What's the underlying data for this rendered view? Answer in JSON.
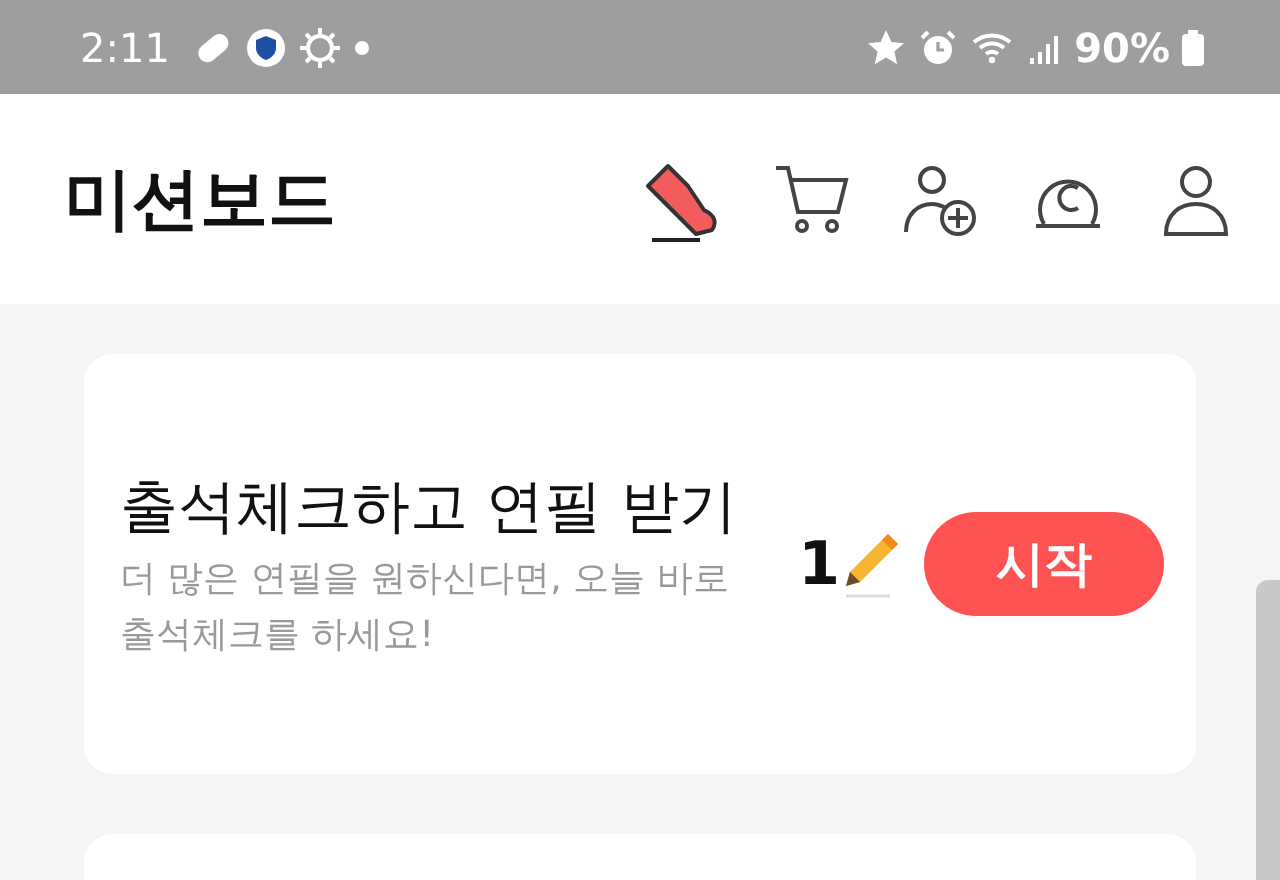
{
  "status_bar": {
    "time": "2:11",
    "battery": "90%"
  },
  "header": {
    "title": "미션보드"
  },
  "missions": [
    {
      "title": "출석체크하고 연필 받기",
      "description": "더 많은 연필을 원하신다면, 오늘 바로 출석체크를 하세요!",
      "reward": "1",
      "button": "시작"
    }
  ]
}
